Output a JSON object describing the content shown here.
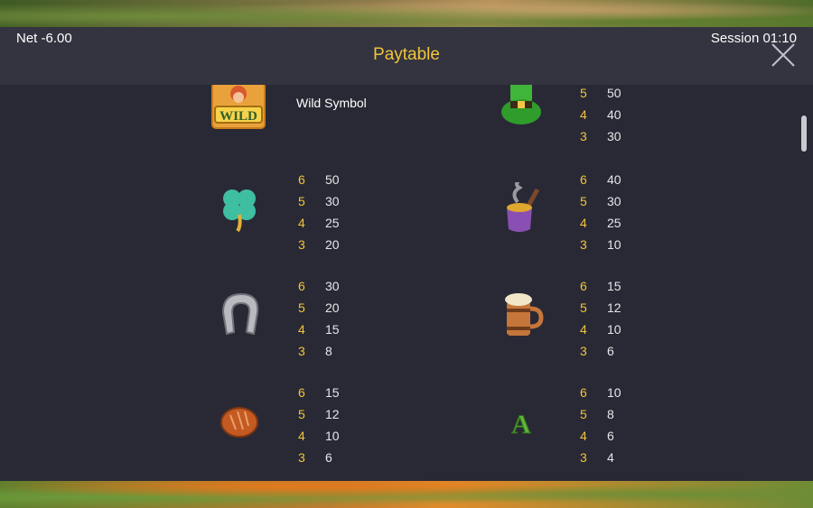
{
  "header": {
    "net_label": "Net -6.00",
    "session_label": "Session 01:10",
    "title": "Paytable",
    "close_icon": "close-icon"
  },
  "symbols": {
    "wild": {
      "icon": "wild-leprechaun-icon",
      "label": "Wild Symbol"
    },
    "hat": {
      "icon": "green-hat-icon",
      "pays": [
        {
          "count": "5",
          "value": "50"
        },
        {
          "count": "4",
          "value": "40"
        },
        {
          "count": "3",
          "value": "30"
        }
      ]
    },
    "clover": {
      "icon": "four-leaf-clover-icon",
      "pays": [
        {
          "count": "6",
          "value": "50"
        },
        {
          "count": "5",
          "value": "30"
        },
        {
          "count": "4",
          "value": "25"
        },
        {
          "count": "3",
          "value": "20"
        }
      ]
    },
    "pipe": {
      "icon": "pipe-icon",
      "pays": [
        {
          "count": "6",
          "value": "40"
        },
        {
          "count": "5",
          "value": "30"
        },
        {
          "count": "4",
          "value": "25"
        },
        {
          "count": "3",
          "value": "10"
        }
      ]
    },
    "horseshoe": {
      "icon": "horseshoe-icon",
      "pays": [
        {
          "count": "6",
          "value": "30"
        },
        {
          "count": "5",
          "value": "20"
        },
        {
          "count": "4",
          "value": "15"
        },
        {
          "count": "3",
          "value": "8"
        }
      ]
    },
    "mug": {
      "icon": "beer-mug-icon",
      "pays": [
        {
          "count": "6",
          "value": "15"
        },
        {
          "count": "5",
          "value": "12"
        },
        {
          "count": "4",
          "value": "10"
        },
        {
          "count": "3",
          "value": "6"
        }
      ]
    },
    "bread": {
      "icon": "bread-icon",
      "pays": [
        {
          "count": "6",
          "value": "15"
        },
        {
          "count": "5",
          "value": "12"
        },
        {
          "count": "4",
          "value": "10"
        },
        {
          "count": "3",
          "value": "6"
        }
      ]
    },
    "letter_a": {
      "icon": "letter-a-icon",
      "pays": [
        {
          "count": "6",
          "value": "10"
        },
        {
          "count": "5",
          "value": "8"
        },
        {
          "count": "4",
          "value": "6"
        },
        {
          "count": "3",
          "value": "4"
        }
      ]
    }
  },
  "colors": {
    "accent": "#f2c43a",
    "panel": "#292935",
    "header": "#33343f"
  }
}
